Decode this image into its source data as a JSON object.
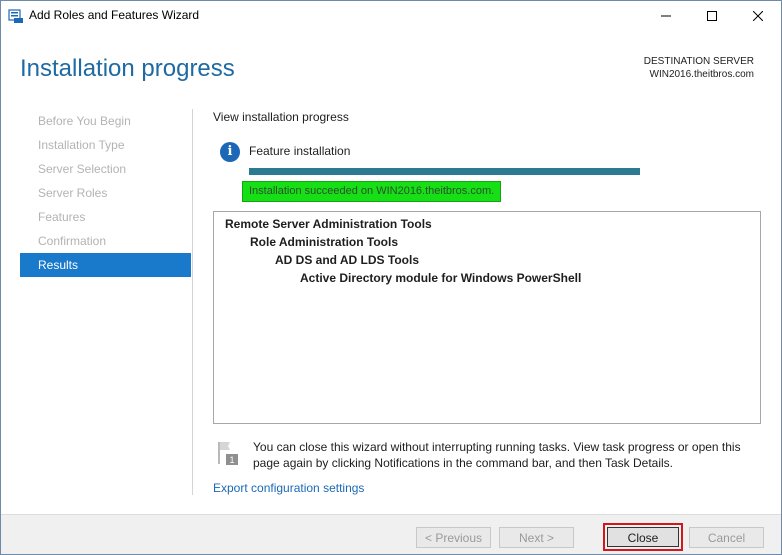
{
  "window": {
    "title": "Add Roles and Features Wizard"
  },
  "header": {
    "page_title": "Installation progress",
    "destination_label": "DESTINATION SERVER",
    "destination_value": "WIN2016.theitbros.com"
  },
  "nav": {
    "items": [
      {
        "label": "Before You Begin",
        "active": false
      },
      {
        "label": "Installation Type",
        "active": false
      },
      {
        "label": "Server Selection",
        "active": false
      },
      {
        "label": "Server Roles",
        "active": false
      },
      {
        "label": "Features",
        "active": false
      },
      {
        "label": "Confirmation",
        "active": false
      },
      {
        "label": "Results",
        "active": true
      }
    ]
  },
  "content": {
    "view_heading": "View installation progress",
    "feature_label": "Feature installation",
    "progress_fraction": 1.0,
    "success_message": "Installation succeeded on WIN2016.theitbros.com.",
    "results_tree": [
      "Remote Server Administration Tools",
      "Role Administration Tools",
      "AD DS and AD LDS Tools",
      "Active Directory module for Windows PowerShell"
    ],
    "note": "You can close this wizard without interrupting running tasks. View task progress or open this page again by clicking Notifications in the command bar, and then Task Details.",
    "export_link": "Export configuration settings"
  },
  "footer": {
    "previous_label": "< Previous",
    "next_label": "Next >",
    "close_label": "Close",
    "cancel_label": "Cancel"
  },
  "colors": {
    "accent": "#1979ca",
    "title_blue": "#1e6aa3",
    "success_bg": "#16e015",
    "progress": "#2b7a91",
    "highlight": "#d4161e"
  }
}
